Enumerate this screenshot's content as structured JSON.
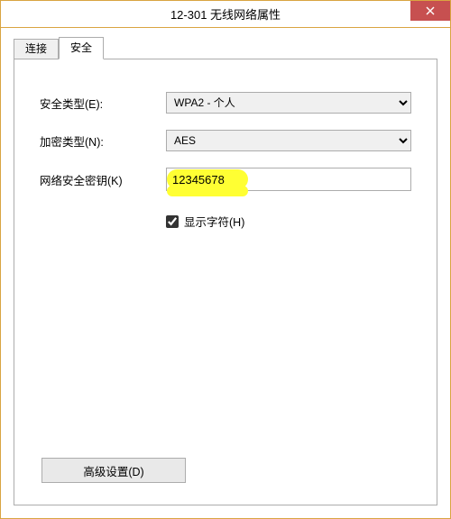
{
  "window": {
    "title": "12-301 无线网络属性",
    "close_icon": "close"
  },
  "tabs": {
    "connect": {
      "label": "连接"
    },
    "security": {
      "label": "安全"
    }
  },
  "security": {
    "security_type_label": "安全类型(E):",
    "encryption_type_label": "加密类型(N):",
    "network_key_label": "网络安全密钥(K)",
    "show_chars_label": "显示字符(H)",
    "advanced_button": "高级设置(D)",
    "security_type_value": "WPA2 - 个人",
    "encryption_type_value": "AES",
    "network_key_value": "12345678",
    "show_chars_checked": true
  }
}
